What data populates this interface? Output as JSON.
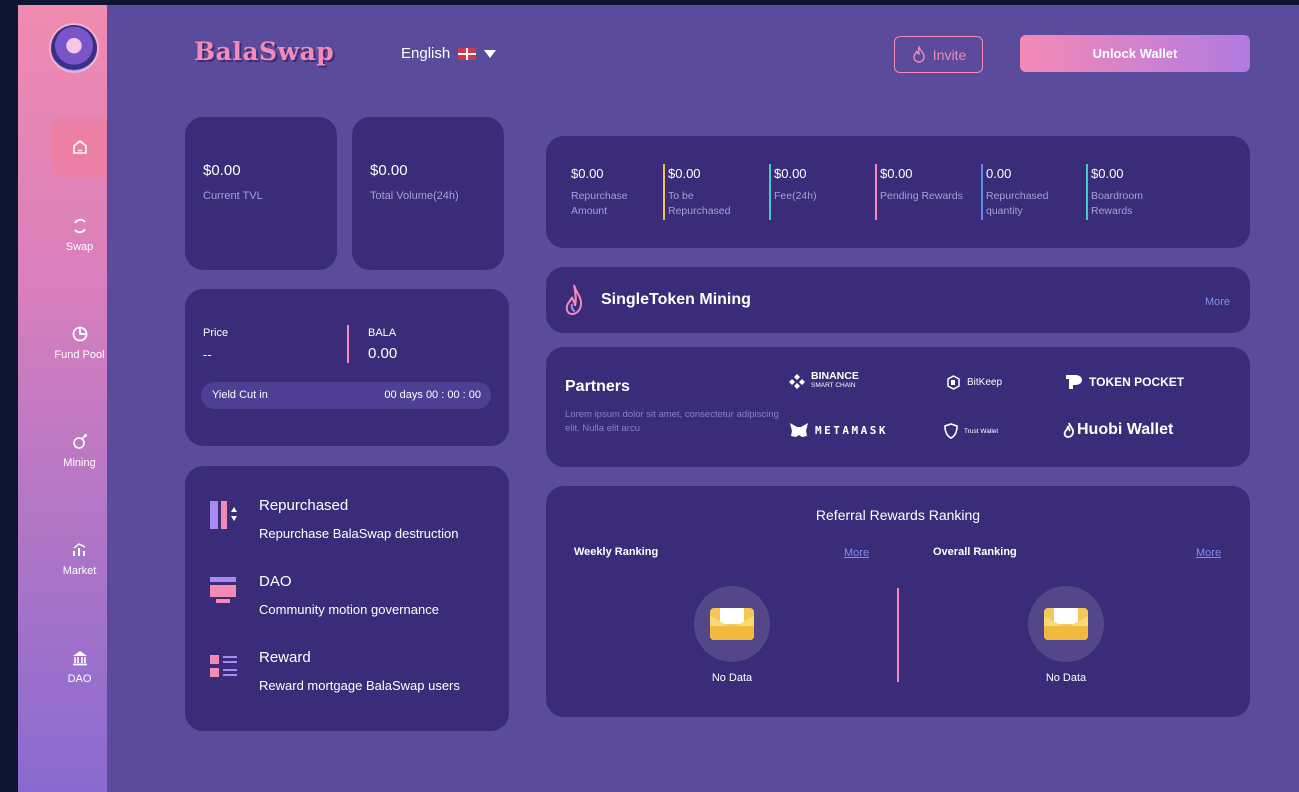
{
  "header": {
    "brand": "BalaSwap",
    "language": "English",
    "invite_label": "Invite",
    "unlock_label": "Unlock Wallet"
  },
  "sidebar": {
    "items": [
      {
        "label": "Swap",
        "icon": "swap-icon"
      },
      {
        "label": "Fund Pool",
        "icon": "pie-chart-icon"
      },
      {
        "label": "Mining",
        "icon": "mining-icon"
      },
      {
        "label": "Market",
        "icon": "market-chart-icon"
      },
      {
        "label": "DAO",
        "icon": "bank-icon"
      }
    ]
  },
  "tvl": {
    "value": "$0.00",
    "label": "Current TVL"
  },
  "volume": {
    "value": "$0.00",
    "label": "Total Volume(24h)"
  },
  "price_card": {
    "price_label": "Price",
    "price_value": "--",
    "token_label": "BALA",
    "token_value": "0.00",
    "yield_label": "Yield Cut in",
    "yield_value": "00 days 00 : 00 : 00"
  },
  "features": [
    {
      "title": "Repurchased",
      "desc": "Repurchase BalaSwap destruction"
    },
    {
      "title": "DAO",
      "desc": "Community motion governance"
    },
    {
      "title": "Reward",
      "desc": "Reward mortgage BalaSwap users"
    }
  ],
  "stats": [
    {
      "value": "$0.00",
      "label1": "Repurchase",
      "label2": "Amount",
      "accent": ""
    },
    {
      "value": "$0.00",
      "label1": "To be",
      "label2": "Repurchased",
      "accent": "#f0c35a"
    },
    {
      "value": "$0.00",
      "label1": "Fee(24h)",
      "label2": "",
      "accent": "#3fd0c4"
    },
    {
      "value": "$0.00",
      "label1": "Pending Rewards",
      "label2": "",
      "accent": "#f48ab6"
    },
    {
      "value": "0.00",
      "label1": "Repurchased",
      "label2": "quantity",
      "accent": "#5a8cf0"
    },
    {
      "value": "$0.00",
      "label1": "Boardroom",
      "label2": "Rewards",
      "accent": "#3fd0c4"
    }
  ],
  "mining": {
    "title": "SingleToken Mining",
    "more": "More"
  },
  "partners": {
    "title": "Partners",
    "desc": "Lorem ipsum dolor sit amet, consectetur adipiscing elit. Nulla elit arcu",
    "logos": {
      "binance": "BINANCE",
      "binance_sub": "SMART CHAIN",
      "bitkeep": "BitKeep",
      "tokenpocket": "TOKEN POCKET",
      "metamask": "METAMASK",
      "trustwallet": "Trust Wallet",
      "huobi": "Huobi Wallet"
    }
  },
  "referral": {
    "title": "Referral Rewards Ranking",
    "weekly": "Weekly Ranking",
    "overall": "Overall Ranking",
    "more": "More",
    "no_data": "No Data"
  },
  "colors": {
    "background": "#5a4b9c",
    "card": "#3a2c78",
    "accent_pink": "#f48ab6"
  }
}
